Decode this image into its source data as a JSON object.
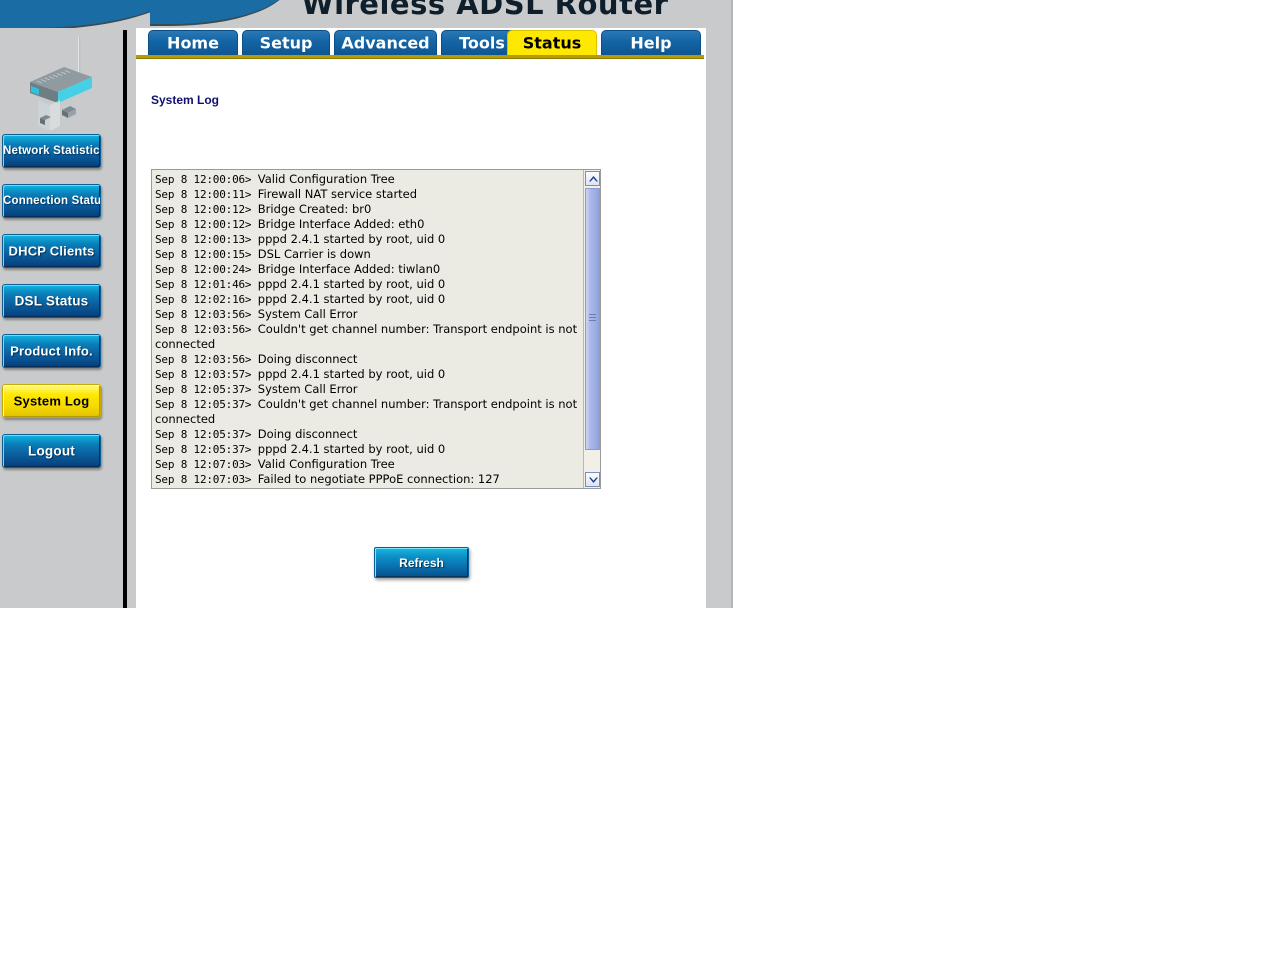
{
  "header": {
    "product_title": "Wireless ADSL Router"
  },
  "sidebar": {
    "device_icon": "wireless-router-illustration",
    "items": [
      {
        "label": "Network Statistics",
        "state": "inactive"
      },
      {
        "label": "Connection Status",
        "state": "inactive"
      },
      {
        "label": "DHCP Clients",
        "state": "inactive"
      },
      {
        "label": "DSL  Status",
        "state": "inactive"
      },
      {
        "label": "Product Info.",
        "state": "inactive"
      },
      {
        "label": "System Log",
        "state": "active"
      },
      {
        "label": "Logout",
        "state": "inactive"
      }
    ]
  },
  "tabs": [
    {
      "label": "Home",
      "active": false
    },
    {
      "label": "Setup",
      "active": false
    },
    {
      "label": "Advanced",
      "active": false
    },
    {
      "label": "Tools",
      "active": false
    },
    {
      "label": "Status",
      "active": true
    },
    {
      "label": "Help",
      "active": false
    }
  ],
  "main": {
    "section_title": "System Log",
    "refresh_label": "Refresh"
  },
  "log": {
    "entries": [
      {
        "ts": "Sep  8 12:00:06>",
        "msg": "Valid Configuration Tree"
      },
      {
        "ts": "Sep  8 12:00:11>",
        "msg": "Firewall NAT service started"
      },
      {
        "ts": "Sep  8 12:00:12>",
        "msg": "Bridge Created: br0"
      },
      {
        "ts": "Sep  8 12:00:12>",
        "msg": "Bridge Interface Added: eth0"
      },
      {
        "ts": "Sep  8 12:00:13>",
        "msg": "pppd 2.4.1 started by root, uid 0"
      },
      {
        "ts": "Sep  8 12:00:15>",
        "msg": "DSL Carrier is down"
      },
      {
        "ts": "Sep  8 12:00:24>",
        "msg": "Bridge Interface Added: tiwlan0"
      },
      {
        "ts": "Sep  8 12:01:46>",
        "msg": "pppd 2.4.1 started by root, uid 0"
      },
      {
        "ts": "Sep  8 12:02:16>",
        "msg": "pppd 2.4.1 started by root, uid 0"
      },
      {
        "ts": "Sep  8 12:03:56>",
        "msg": "System Call Error"
      },
      {
        "ts": "Sep  8 12:03:56>",
        "msg": "Couldn't get channel number: Transport endpoint is not connected"
      },
      {
        "ts": "Sep  8 12:03:56>",
        "msg": "Doing disconnect"
      },
      {
        "ts": "Sep  8 12:03:57>",
        "msg": "pppd 2.4.1 started by root, uid 0"
      },
      {
        "ts": "Sep  8 12:05:37>",
        "msg": "System Call Error"
      },
      {
        "ts": "Sep  8 12:05:37>",
        "msg": "Couldn't get channel number: Transport endpoint is not connected"
      },
      {
        "ts": "Sep  8 12:05:37>",
        "msg": "Doing disconnect"
      },
      {
        "ts": "Sep  8 12:05:37>",
        "msg": "pppd 2.4.1 started by root, uid 0"
      },
      {
        "ts": "Sep  8 12:07:03>",
        "msg": "Valid Configuration Tree"
      },
      {
        "ts": "Sep  8 12:07:03>",
        "msg": "Failed to negotiate PPPoE connection: 127"
      }
    ]
  },
  "scrollbar": {
    "up_icon": "chevron-up-icon",
    "down_icon": "chevron-down-icon",
    "grip_icon": "grip-icon"
  },
  "colors": {
    "tab_blue": "#1464a4",
    "tab_active_yellow": "#ffe800",
    "sidebar_bg": "#c8cacb",
    "log_bg": "#ebebe3",
    "title_navy": "#10106e",
    "banner_blue": "#1a6ca4"
  }
}
